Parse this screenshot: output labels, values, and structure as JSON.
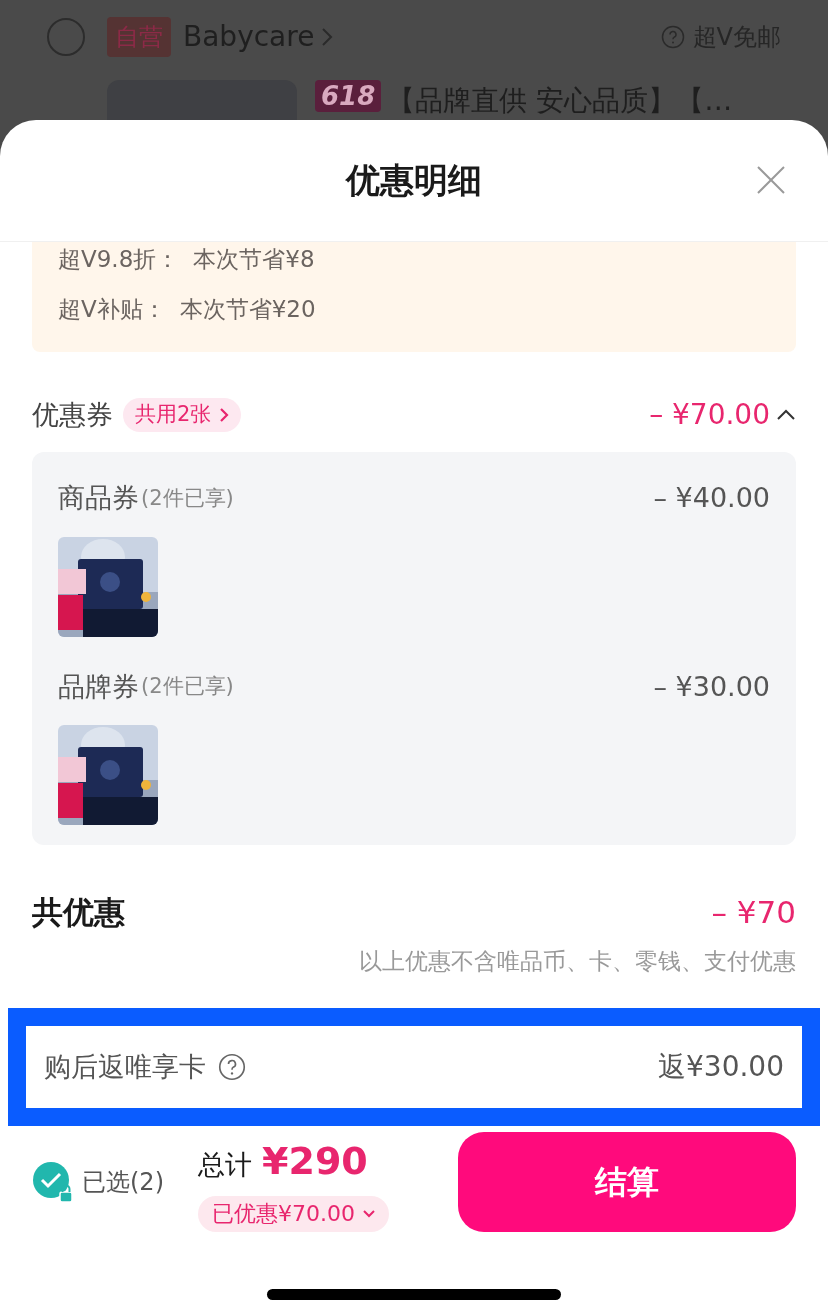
{
  "background": {
    "selected": false,
    "store_tag": "自营",
    "store_name": "Babycare",
    "shipping": "超V免邮",
    "promo_badge": "618",
    "product_title": "【品牌直供 安心品质】【…"
  },
  "sheet": {
    "title": "优惠明细"
  },
  "discounts": [
    {
      "label": "超V9.8折：",
      "value": "本次节省¥8"
    },
    {
      "label": "超V补贴：",
      "value": "本次节省¥20"
    }
  ],
  "coupons": {
    "label": "优惠券",
    "tag": "共用2张",
    "amount": "– ¥70.00",
    "expanded": true,
    "items": [
      {
        "name": "商品券",
        "note": "(2件已享)",
        "amount": "– ¥40.00"
      },
      {
        "name": "品牌券",
        "note": "(2件已享)",
        "amount": "– ¥30.00"
      }
    ]
  },
  "total_discount": {
    "label": "共优惠",
    "amount": "– ¥70",
    "note": "以上优惠不含唯品币、卡、零钱、支付优惠"
  },
  "rebate": {
    "label": "购后返唯享卡",
    "value": "返¥30.00",
    "highlighted": true
  },
  "footer": {
    "selected": true,
    "selected_label": "已选(2)",
    "total_label": "总计",
    "total": "¥290",
    "saved": "已优惠¥70.00",
    "checkout": "结算"
  }
}
